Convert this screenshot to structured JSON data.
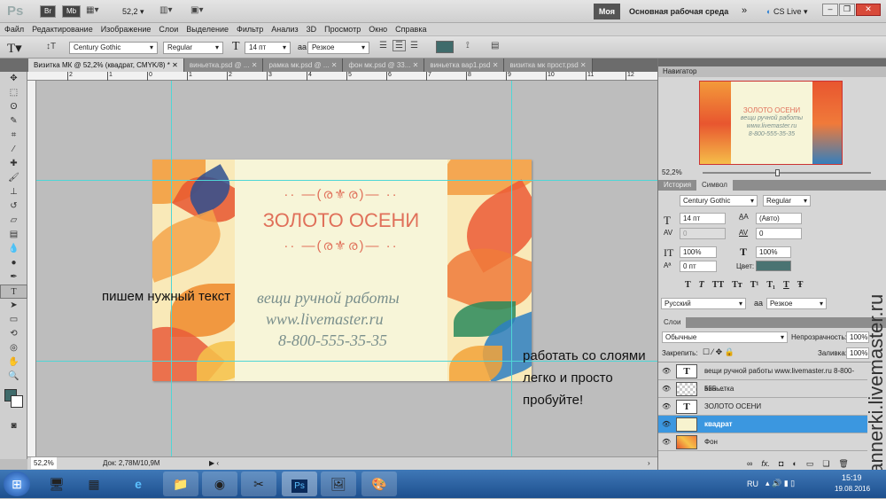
{
  "appbar": {
    "logo": "Ps",
    "br": "Br",
    "mb": "Mb",
    "zoom": "52,2",
    "workspace_btn": "Моя",
    "workspace": "Основная рабочая среда",
    "more": "»",
    "cslive": "CS Live"
  },
  "menu": [
    "Файл",
    "Редактирование",
    "Изображение",
    "Слои",
    "Выделение",
    "Фильтр",
    "Анализ",
    "3D",
    "Просмотр",
    "Окно",
    "Справка"
  ],
  "options": {
    "font": "Century Gothic",
    "style": "Regular",
    "size": "14 пт",
    "aa": "Резкое",
    "color": "#3f6b6b"
  },
  "tabs": [
    "Визитка МК @ 52,2% (квадрат, CMYK/8) *",
    "виньетка.psd @ ...",
    "рамка мк.psd @ ...",
    "фон мк.psd @ 33...",
    "виньетка вар1.psd",
    "визитка мк прост.psd"
  ],
  "ruler_labels": [
    "2",
    "1",
    "0",
    "1",
    "2",
    "3",
    "4",
    "5",
    "6",
    "7",
    "8",
    "9",
    "10",
    "11",
    "12"
  ],
  "card": {
    "title": "ЗОЛОТО ОСЕНИ",
    "line1": "вещи ручной работы",
    "line2": "www.livemaster.ru",
    "line3": "8-800-555-35-35",
    "title_color": "#e0705a",
    "text_color": "#7a8f8c"
  },
  "annotations": {
    "left": "пишем нужный текст",
    "right": [
      "работать со слоями",
      "легко и просто",
      "пробуйте!"
    ]
  },
  "status": {
    "zoom": "52,2%",
    "doc": "Док: 2,78М/10,9М"
  },
  "navigator": {
    "title": "Навигатор",
    "zoom": "52,2%",
    "preview_title": "ЗОЛОТО ОСЕНИ",
    "preview_lines": [
      "вещи ручной работы",
      "www.livemaster.ru",
      "8-800-555-35-35"
    ]
  },
  "character": {
    "tabs": [
      "История",
      "Символ"
    ],
    "font": "Century Gothic",
    "style": "Regular",
    "size": "14 пт",
    "leading": "(Авто)",
    "kerning": "0",
    "tracking": "0",
    "vscale": "100%",
    "hscale": "100%",
    "baseline": "0 пт",
    "color_label": "Цвет:",
    "color": "#4a7372",
    "styles": [
      "T",
      "T",
      "TT",
      "Tт",
      "T¹",
      "T₁",
      "T",
      "Ŧ"
    ],
    "language": "Русский",
    "aa": "Резкое"
  },
  "layers": {
    "tab": "Слои",
    "blend": "Обычные",
    "opacity_label": "Непрозрачность:",
    "opacity": "100%",
    "lock_label": "Закрепить:",
    "fill_label": "Заливка:",
    "fill": "100%",
    "items": [
      {
        "name": "вещи ручной работы www.livemaster.ru 8-800-555-...",
        "type": "text"
      },
      {
        "name": "виньетка",
        "type": "raster"
      },
      {
        "name": "ЗОЛОТО ОСЕНИ",
        "type": "text"
      },
      {
        "name": "квадрат",
        "type": "raster",
        "selected": true
      },
      {
        "name": "Фон",
        "type": "image"
      }
    ],
    "footer_icons": [
      "link",
      "fx",
      "mask",
      "adjustment",
      "group",
      "new-layer",
      "trash"
    ]
  },
  "watermark": "bannerki.livemaster.ru",
  "taskbar": {
    "lang": "RU",
    "time": "15:19",
    "date": "19.08.2016",
    "faded_title": "...",
    "apps": [
      "start",
      "monitor",
      "calculator",
      "ie",
      "explorer",
      "chrome",
      "scissors",
      "photoshop",
      "photo-viewer",
      "paint"
    ]
  }
}
